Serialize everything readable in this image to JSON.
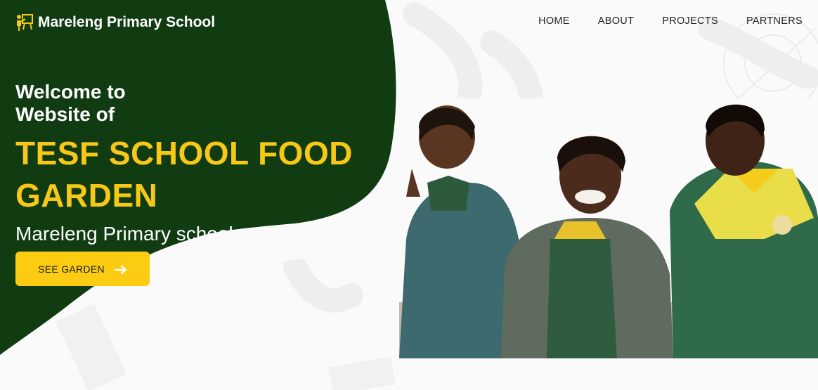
{
  "brand": {
    "name": "Mareleng Primary School",
    "icon": "teacher-board-icon"
  },
  "nav": {
    "items": [
      {
        "label": "HOME"
      },
      {
        "label": "ABOUT"
      },
      {
        "label": "PROJECTS"
      },
      {
        "label": "PARTNERS"
      }
    ]
  },
  "hero": {
    "welcome": "Welcome to Website of",
    "title": "TESF SCHOOL FOOD GARDEN",
    "subtitle": "Mareleng Primary school",
    "cta_label": "SEE GARDEN",
    "cta_icon": "arrow-right-icon"
  },
  "photo": {
    "icon": "students-photo"
  },
  "colors": {
    "green": "#113c12",
    "yellow": "#f7c818",
    "button": "#fccc12",
    "background": "#fafafa"
  }
}
